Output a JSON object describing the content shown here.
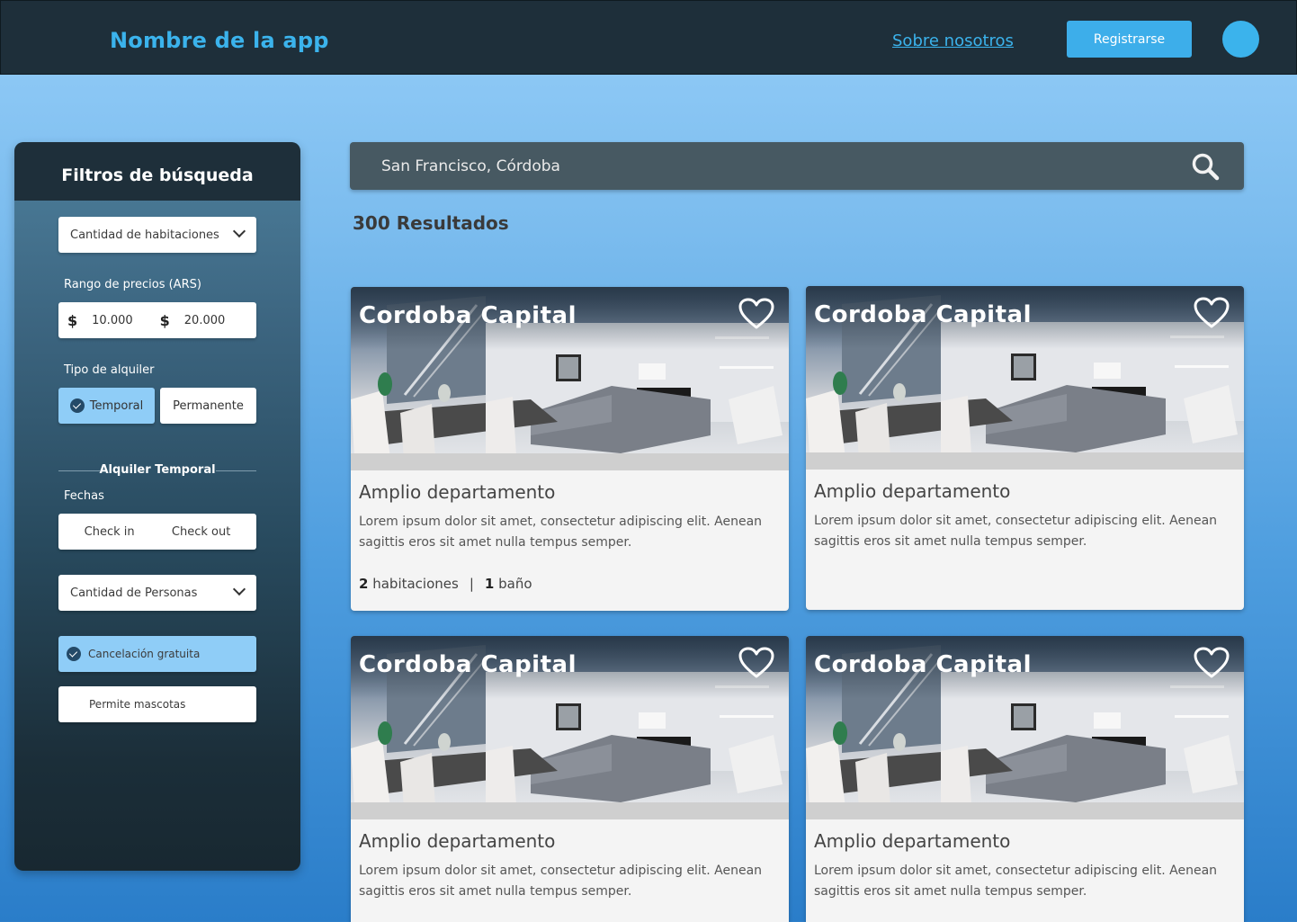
{
  "header": {
    "app_name": "Nombre de la app",
    "about_link": "Sobre nosotros",
    "register_label": "Registrarse"
  },
  "filters": {
    "title": "Filtros de búsqueda",
    "rooms_select": "Cantidad de habitaciones",
    "price_label": "Rango de precios (ARS)",
    "price_currency": "$",
    "price_min": "10.000",
    "price_max": "20.000",
    "rental_type_label": "Tipo de alquiler",
    "rental_temporary": "Temporal",
    "rental_permanent": "Permanente",
    "temporary_section": "Alquiler Temporal",
    "dates_label": "Fechas",
    "check_in": "Check in",
    "check_out": "Check out",
    "people_select": "Cantidad de Personas",
    "free_cancellation": "Cancelación gratuita",
    "pets_allowed": "Permite mascotas"
  },
  "search": {
    "value": "San Francisco, Córdoba"
  },
  "results_count": "300 Resultados",
  "colors": {
    "accent": "#3bb3ec",
    "header_bg": "#1e2f3a",
    "selected_filter": "#8fcdf7"
  },
  "listings": [
    {
      "location": "Cordoba Capital",
      "title": "Amplio departamento",
      "description": "Lorem ipsum dolor sit amet, consectetur adipiscing elit. Aenean sagittis eros sit amet nulla tempus semper.",
      "rooms_num": "2",
      "rooms_text": "habitaciones",
      "separator": "|",
      "baths_num": "1",
      "baths_text": "baño"
    },
    {
      "location": "Cordoba Capital",
      "title": "Amplio departamento",
      "description": "Lorem ipsum dolor sit amet, consectetur adipiscing elit. Aenean sagittis eros sit amet nulla tempus semper."
    },
    {
      "location": "Cordoba Capital",
      "title": "Amplio departamento",
      "description": "Lorem ipsum dolor sit amet, consectetur adipiscing elit. Aenean sagittis eros sit amet nulla tempus semper."
    },
    {
      "location": "Cordoba Capital",
      "title": "Amplio departamento",
      "description": "Lorem ipsum dolor sit amet, consectetur adipiscing elit. Aenean sagittis eros sit amet nulla tempus semper."
    }
  ]
}
